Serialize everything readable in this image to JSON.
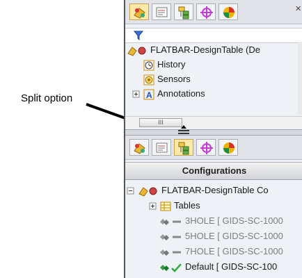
{
  "annotation": {
    "label": "Split option"
  },
  "top_pane": {
    "tabs": [
      "feature-manager-tab",
      "property-manager-tab",
      "configuration-manager-tab",
      "dimxpert-tab",
      "display-manager-tab"
    ],
    "close_symbol": "×",
    "filter_icon": "filter-icon",
    "tree": [
      {
        "label": "FLATBAR-DesignTable  (De",
        "icon": "part-icon"
      },
      {
        "label": "History",
        "icon": "history-icon"
      },
      {
        "label": "Sensors",
        "icon": "sensors-icon"
      },
      {
        "label": "Annotations",
        "icon": "annotations-icon"
      }
    ],
    "scroll_thumb": "III"
  },
  "bottom_pane": {
    "header": "Configurations",
    "tree": [
      {
        "label": "FLATBAR-DesignTable Co",
        "icon": "part-icon"
      },
      {
        "label": "Tables",
        "icon": "tables-icon"
      },
      {
        "label": "3HOLE [ GIDS-SC-1000",
        "icon": "config-icon",
        "dim": true
      },
      {
        "label": "5HOLE [ GIDS-SC-1000",
        "icon": "config-icon",
        "dim": true
      },
      {
        "label": "7HOLE [ GIDS-SC-1000",
        "icon": "config-icon",
        "dim": true
      },
      {
        "label": "Default [ GIDS-SC-100",
        "icon": "config-active-icon",
        "dim": false
      }
    ]
  }
}
